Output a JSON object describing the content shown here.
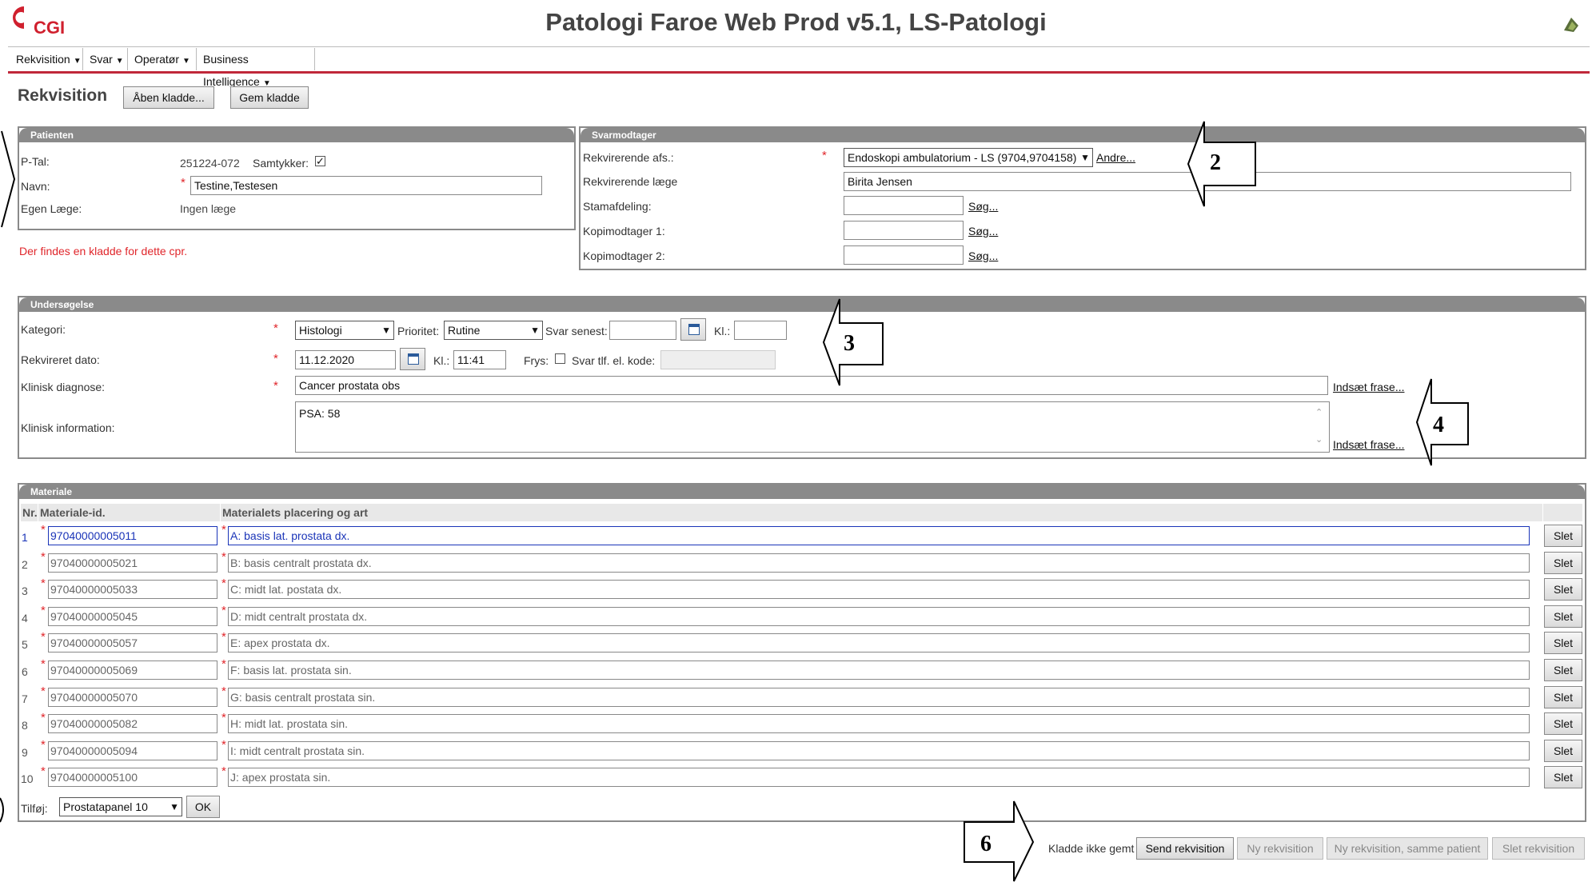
{
  "header": {
    "logo_text": "CGI",
    "title": "Patologi Faroe Web Prod v5.1, LS-Patologi"
  },
  "menu": [
    {
      "label": "Rekvisition"
    },
    {
      "label": "Svar"
    },
    {
      "label": "Operatør"
    },
    {
      "label": "Business Intelligence"
    }
  ],
  "page": {
    "title": "Rekvisition",
    "open_draft_button": "Åben kladde...",
    "save_draft_button": "Gem kladde"
  },
  "patient": {
    "header": "Patienten",
    "ptal_label": "P-Tal:",
    "ptal_value": "251224-072",
    "consent_label": "Samtykker:",
    "consent_checked": "✓",
    "name_label": "Navn:",
    "name_value": "Testine,Testesen",
    "doctor_label": "Egen Læge:",
    "doctor_value": "Ingen læge",
    "draft_note": "Der findes en kladde for dette cpr."
  },
  "receiver": {
    "header": "Svarmodtager",
    "dept_label": "Rekvirerende afs.:",
    "dept_value": "Endoskopi ambulatorium - LS (9704,9704158)",
    "other_link": "Andre...",
    "doctor_label": "Rekvirerende læge",
    "doctor_value": "Birita Jensen",
    "master_label": "Stamafdeling:",
    "copy1_label": "Kopimodtager 1:",
    "copy2_label": "Kopimodtager 2:",
    "search_link": "Søg..."
  },
  "exam": {
    "header": "Undersøgelse",
    "category_label": "Kategori:",
    "category_value": "Histologi",
    "priority_label": "Prioritet:",
    "priority_value": "Rutine",
    "answer_by_label": "Svar senest:",
    "time_label": "Kl.:",
    "date_label": "Rekvireret dato:",
    "date_value": "11.12.2020",
    "time_value": "11:41",
    "freeze_label": "Frys:",
    "phone_label": "Svar tlf. el. kode:",
    "diagnosis_label": "Klinisk diagnose:",
    "diagnosis_value": "Cancer prostata obs",
    "info_label": "Klinisk information:",
    "info_value": "PSA: 58",
    "insert_phrase_link": "Indsæt frase..."
  },
  "material": {
    "header": "Materiale",
    "col_nr": "Nr.",
    "col_id": "Materiale-id.",
    "col_desc": "Materialets placering og art",
    "delete_label": "Slet",
    "rows": [
      {
        "nr": "1",
        "id": "97040000005011",
        "desc": "A: basis lat. prostata dx."
      },
      {
        "nr": "2",
        "id": "97040000005021",
        "desc": "B: basis centralt prostata dx."
      },
      {
        "nr": "3",
        "id": "97040000005033",
        "desc": "C: midt lat. postata dx."
      },
      {
        "nr": "4",
        "id": "97040000005045",
        "desc": "D: midt centralt prostata dx."
      },
      {
        "nr": "5",
        "id": "97040000005057",
        "desc": "E: apex prostata dx."
      },
      {
        "nr": "6",
        "id": "97040000005069",
        "desc": "F: basis lat. prostata sin."
      },
      {
        "nr": "7",
        "id": "97040000005070",
        "desc": "G: basis centralt prostata sin."
      },
      {
        "nr": "8",
        "id": "97040000005082",
        "desc": "H: midt lat. prostata sin."
      },
      {
        "nr": "9",
        "id": "97040000005094",
        "desc": "I: midt centralt prostata sin."
      },
      {
        "nr": "10",
        "id": "97040000005100",
        "desc": "J: apex prostata sin."
      }
    ],
    "add_label": "Tilføj:",
    "add_value": "Prostatapanel 10",
    "ok_label": "OK"
  },
  "footer": {
    "status": "Kladde ikke gemt",
    "send": "Send rekvisition",
    "new": "Ny rekvisition",
    "new_same": "Ny rekvisition, samme patient",
    "delete": "Slet rekvisition"
  },
  "annotations": {
    "n2": "2",
    "n3": "3",
    "n4": "4",
    "n6": "6"
  }
}
